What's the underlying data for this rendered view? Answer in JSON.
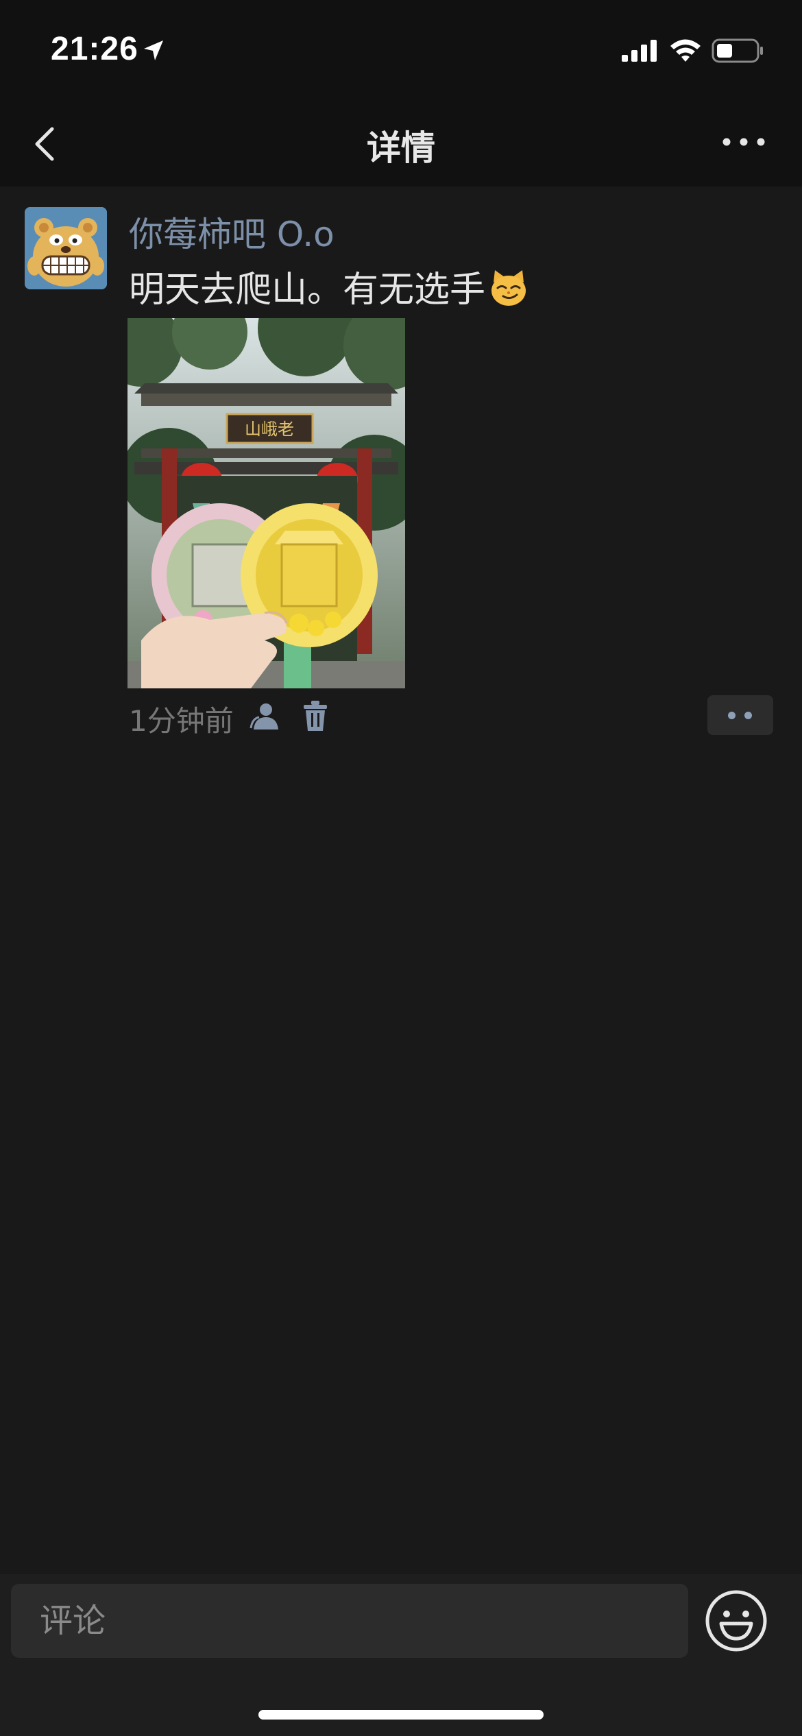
{
  "status_bar": {
    "time": "21:26",
    "icons": [
      "location-arrow-icon",
      "cellular-signal-icon",
      "wifi-icon",
      "battery-icon"
    ]
  },
  "nav": {
    "title": "详情",
    "back_icon": "chevron-left-icon",
    "more_icon": "more-dots-icon"
  },
  "post": {
    "author": "你莓柿吧 O.o",
    "text": "明天去爬山。有无选手",
    "text_emoji": "cat-smirk-emoji",
    "image": "medal-photo-in-front-of-gate",
    "image_signboard_text": "山峨老",
    "time": "1分钟前",
    "meta_icons": [
      "privacy-person-icon",
      "trash-icon"
    ],
    "action_icon": "two-dots-icon"
  },
  "comment_bar": {
    "placeholder": "评论",
    "emoji_icon": "smiley-face-icon"
  },
  "colors": {
    "background": "#191919",
    "bars": "#111111",
    "author_name": "#7d90a9",
    "text": "#e6e6e6",
    "muted": "#777777"
  }
}
